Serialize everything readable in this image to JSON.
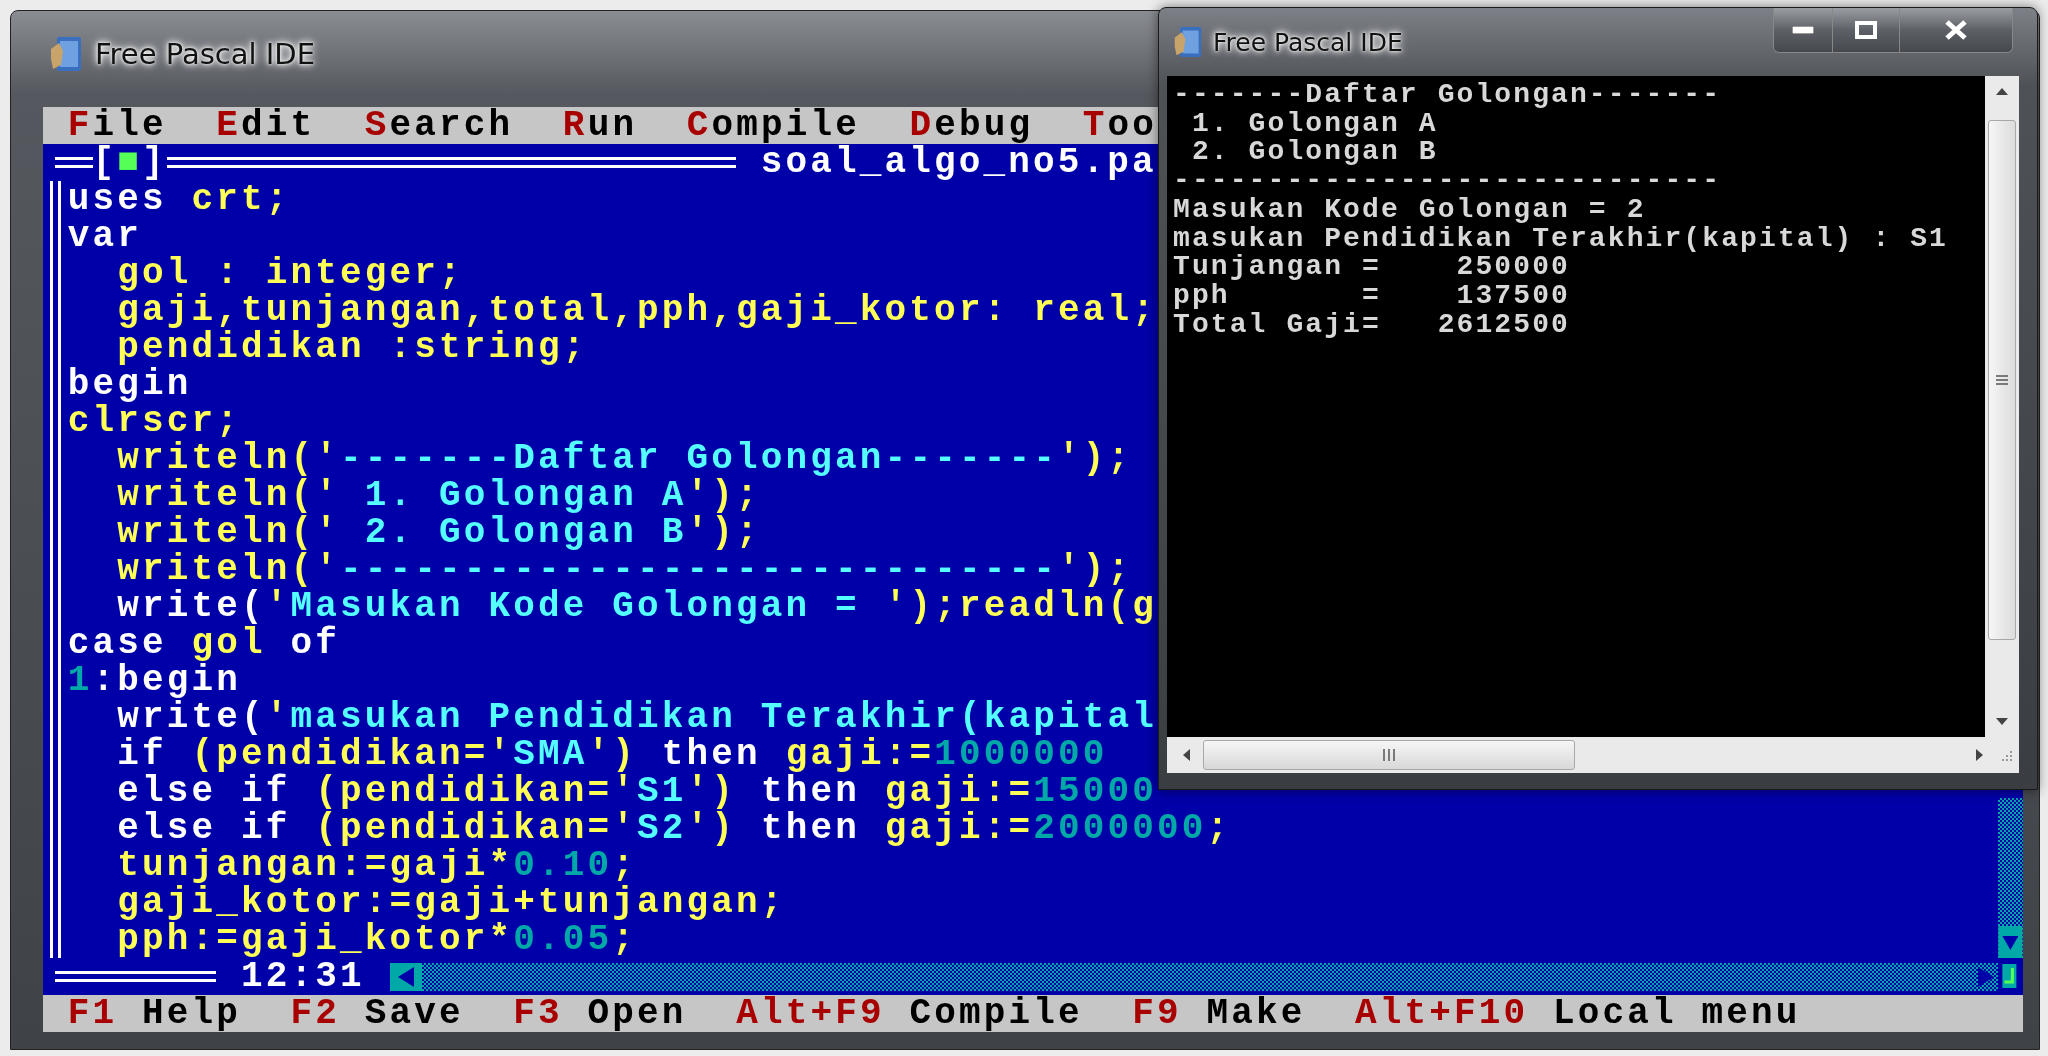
{
  "ide_window": {
    "title": "Free Pascal IDE",
    "menu": [
      {
        "label": "File"
      },
      {
        "label": "Edit"
      },
      {
        "label": "Search"
      },
      {
        "label": "Run"
      },
      {
        "label": "Compile"
      },
      {
        "label": "Debug"
      },
      {
        "label": "Too"
      }
    ],
    "editor": {
      "close_box": "[■]",
      "file_name": "soal_algo_no5.pa",
      "time": "12:31",
      "lines": [
        [
          {
            "kind": "keyword",
            "text": "uses "
          },
          {
            "kind": "identifier",
            "text": "crt;"
          }
        ],
        [
          {
            "kind": "keyword",
            "text": "var"
          }
        ],
        [
          {
            "kind": "identifier",
            "text": "  gol : integer;"
          }
        ],
        [
          {
            "kind": "identifier",
            "text": "  gaji,tunjangan,total,pph,gaji_kotor: real;"
          }
        ],
        [
          {
            "kind": "identifier",
            "text": "  pendidikan :string;"
          }
        ],
        [
          {
            "kind": "keyword",
            "text": "begin"
          }
        ],
        [
          {
            "kind": "identifier",
            "text": "clrscr;"
          }
        ],
        [
          {
            "kind": "identifier",
            "text": "  writeln('"
          },
          {
            "kind": "string",
            "text": "-------Daftar Golongan-------"
          },
          {
            "kind": "identifier",
            "text": "');"
          }
        ],
        [
          {
            "kind": "identifier",
            "text": "  writeln('"
          },
          {
            "kind": "string",
            "text": " 1. Golongan A"
          },
          {
            "kind": "identifier",
            "text": "');"
          }
        ],
        [
          {
            "kind": "identifier",
            "text": "  writeln('"
          },
          {
            "kind": "string",
            "text": " 2. Golongan B"
          },
          {
            "kind": "identifier",
            "text": "');"
          }
        ],
        [
          {
            "kind": "identifier",
            "text": "  writeln('"
          },
          {
            "kind": "string",
            "text": "-----------------------------"
          },
          {
            "kind": "identifier",
            "text": "');"
          }
        ],
        [
          {
            "kind": "keyword",
            "text": "  write("
          },
          {
            "kind": "identifier",
            "text": "'"
          },
          {
            "kind": "string",
            "text": "Masukan Kode Golongan = "
          },
          {
            "kind": "identifier",
            "text": "');readln(g"
          }
        ],
        [
          {
            "kind": "keyword",
            "text": "case "
          },
          {
            "kind": "identifier",
            "text": "gol"
          },
          {
            "kind": "keyword",
            "text": " of"
          }
        ],
        [
          {
            "kind": "number",
            "text": "1"
          },
          {
            "kind": "keyword",
            "text": ":begin"
          }
        ],
        [
          {
            "kind": "keyword",
            "text": "  write("
          },
          {
            "kind": "identifier",
            "text": "'"
          },
          {
            "kind": "string",
            "text": "masukan Pendidikan Terakhir(kapital"
          }
        ],
        [
          {
            "kind": "keyword",
            "text": "  if "
          },
          {
            "kind": "identifier",
            "text": "(pendidikan='"
          },
          {
            "kind": "string",
            "text": "SMA"
          },
          {
            "kind": "identifier",
            "text": "') "
          },
          {
            "kind": "keyword",
            "text": "then "
          },
          {
            "kind": "identifier",
            "text": "gaji:="
          },
          {
            "kind": "number",
            "text": "1000000"
          }
        ],
        [
          {
            "kind": "keyword",
            "text": "  else if "
          },
          {
            "kind": "identifier",
            "text": "(pendidikan='"
          },
          {
            "kind": "string",
            "text": "S1"
          },
          {
            "kind": "identifier",
            "text": "') "
          },
          {
            "kind": "keyword",
            "text": "then "
          },
          {
            "kind": "identifier",
            "text": "gaji:="
          },
          {
            "kind": "number",
            "text": "15000"
          }
        ],
        [
          {
            "kind": "keyword",
            "text": "  else if "
          },
          {
            "kind": "identifier",
            "text": "(pendidikan='"
          },
          {
            "kind": "string",
            "text": "S2"
          },
          {
            "kind": "identifier",
            "text": "') "
          },
          {
            "kind": "keyword",
            "text": "then "
          },
          {
            "kind": "identifier",
            "text": "gaji:="
          },
          {
            "kind": "number",
            "text": "2000000"
          },
          {
            "kind": "identifier",
            "text": ";"
          }
        ],
        [
          {
            "kind": "identifier",
            "text": "  tunjangan:=gaji*"
          },
          {
            "kind": "number",
            "text": "0.10"
          },
          {
            "kind": "identifier",
            "text": ";"
          }
        ],
        [
          {
            "kind": "identifier",
            "text": "  gaji_kotor:=gaji+tunjangan;"
          }
        ],
        [
          {
            "kind": "identifier",
            "text": "  pph:=gaji_kotor*"
          },
          {
            "kind": "number",
            "text": "0.05"
          },
          {
            "kind": "identifier",
            "text": ";"
          }
        ]
      ]
    },
    "status_bar": [
      {
        "key": "F1",
        "label": "Help"
      },
      {
        "key": "F2",
        "label": "Save"
      },
      {
        "key": "F3",
        "label": "Open"
      },
      {
        "key": "Alt+F9",
        "label": "Compile"
      },
      {
        "key": "F9",
        "label": "Make"
      },
      {
        "key": "Alt+F10",
        "label": "Local menu"
      }
    ]
  },
  "console_window": {
    "title": "Free Pascal IDE",
    "lines": [
      "-------Daftar Golongan-------",
      " 1. Golongan A",
      " 2. Golongan B",
      "-----------------------------",
      "Masukan Kode Golongan = 2",
      "masukan Pendidikan Terakhir(kapital) : S1",
      "Tunjangan =    250000",
      "pph       =    137500",
      "Total Gaji=   2612500"
    ]
  }
}
